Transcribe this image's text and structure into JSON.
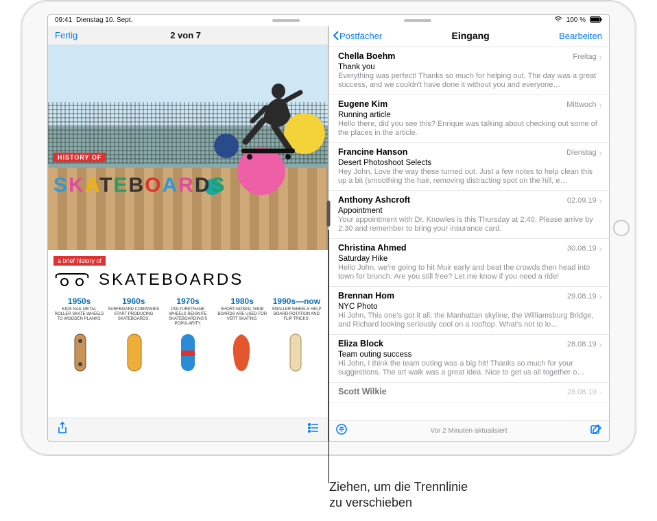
{
  "statusbar": {
    "time": "09:41",
    "date": "Dienstag 10. Sept.",
    "battery": "100 %"
  },
  "left": {
    "done": "Fertig",
    "counter": "2 von 7",
    "history_badge": "HISTORY OF",
    "big_word": "SKATEBOARDS",
    "brief_badge": "a brief history of",
    "brief_title": "SKATEBOARDS",
    "decades": [
      {
        "year": "1950s",
        "text": "KIDS NAIL METAL ROLLER SKATE WHEELS TO WOODEN PLANKS."
      },
      {
        "year": "1960s",
        "text": "SURFBOARD COMPANIES START PRODUCING SKATEBOARDS."
      },
      {
        "year": "1970s",
        "text": "POLYURETHANE WHEELS REIGNITE SKATEBOARDING'S POPULARITY."
      },
      {
        "year": "1980s",
        "text": "SHORT-NOSED, WIDE BOARDS ARE USED FOR VERT SKATING."
      },
      {
        "year": "1990s—now",
        "text": "SMALLER WHEELS HELP BOARD ROTATION AND FLIP TRICKS."
      }
    ]
  },
  "mail": {
    "back": "Postfächer",
    "title": "Eingang",
    "edit": "Bearbeiten",
    "footer_status": "Vor 2 Minuten aktualisiert",
    "items": [
      {
        "sender": "Chella Boehm",
        "date": "Freitag",
        "subject": "Thank you",
        "preview": "Everything was perfect! Thanks so much for helping out. The day was a great success, and we couldn't have done it without you and everyone…"
      },
      {
        "sender": "Eugene Kim",
        "date": "Mittwoch",
        "subject": "Running article",
        "preview": "Hello there, did you see this? Enrique was talking about checking out some of the places in the article."
      },
      {
        "sender": "Francine Hanson",
        "date": "Dienstag",
        "subject": "Desert Photoshoot Selects",
        "preview": "Hey John, Love the way these turned out. Just a few notes to help clean this up a bit (smoothing the hair, removing distracting spot on the hill, e…"
      },
      {
        "sender": "Anthony Ashcroft",
        "date": "02.09.19",
        "subject": "Appointment",
        "preview": "Your appointment with Dr. Knowles is this Thursday at 2:40. Please arrive by 2:30 and remember to bring your insurance card."
      },
      {
        "sender": "Christina Ahmed",
        "date": "30.08.19",
        "subject": "Saturday Hike",
        "preview": "Hello John, we're going to hit Muir early and beat the crowds then head into town for brunch. Are you still free? Let me know if you need a ride!"
      },
      {
        "sender": "Brennan Hom",
        "date": "29.08.19",
        "subject": "NYC Photo",
        "preview": "Hi John, This one's got it all: the Manhattan skyline, the Williamsburg Bridge, and Richard looking seriously cool on a rooftop. What's not to lo…"
      },
      {
        "sender": "Eliza Block",
        "date": "28.08.19",
        "subject": "Team outing success",
        "preview": "Hi John, I think the team outing was a big hit! Thanks so much for your suggestions. The art walk was a great idea. Nice to get us all together o…"
      },
      {
        "sender": "Scott Wilkie",
        "date": "28.08.19",
        "subject": "",
        "preview": ""
      }
    ]
  },
  "callout": {
    "line1": "Ziehen, um die Trennlinie",
    "line2": "zu verschieben"
  }
}
